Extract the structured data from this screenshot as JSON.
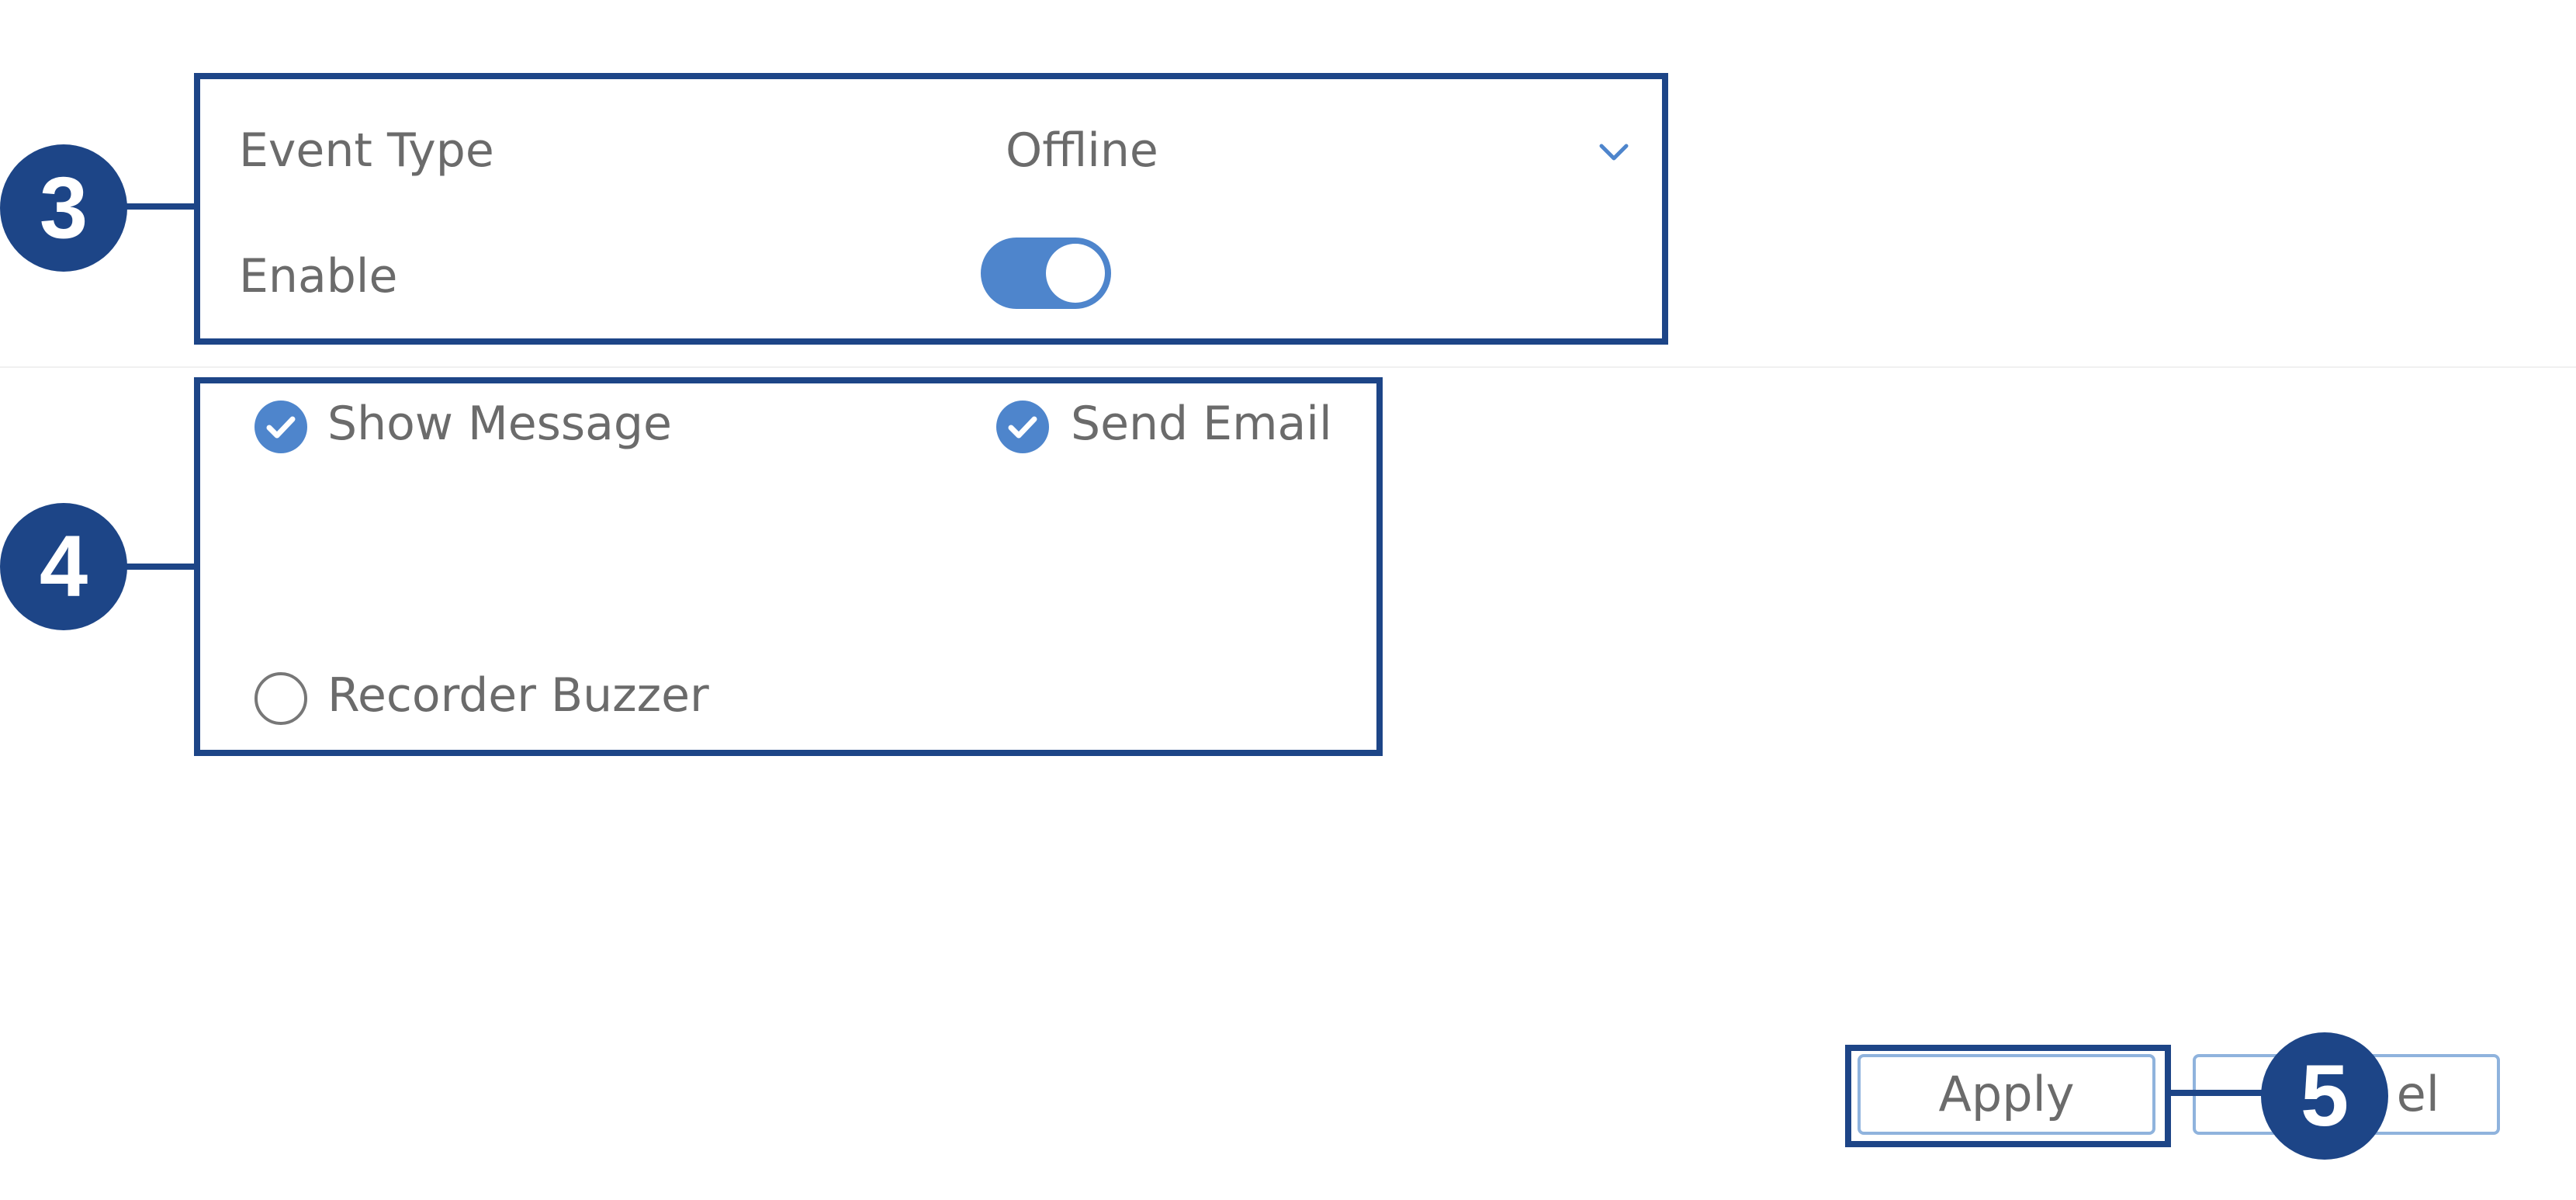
{
  "event_settings": {
    "event_type_label": "Event Type",
    "event_type_value": "Offline",
    "enable_label": "Enable",
    "enable_state": true
  },
  "actions": {
    "show_message_label": "Show Message",
    "show_message_checked": true,
    "send_email_label": "Send Email",
    "send_email_checked": true,
    "recorder_buzzer_label": "Recorder Buzzer",
    "recorder_buzzer_checked": false
  },
  "buttons": {
    "apply_label": "Apply",
    "cancel_label_visible": "el"
  },
  "annotations": {
    "callout_3": "3",
    "callout_4": "4",
    "callout_5": "5"
  },
  "colors": {
    "annotation_navy": "#1d4587",
    "accent_blue": "#4e85cc"
  }
}
